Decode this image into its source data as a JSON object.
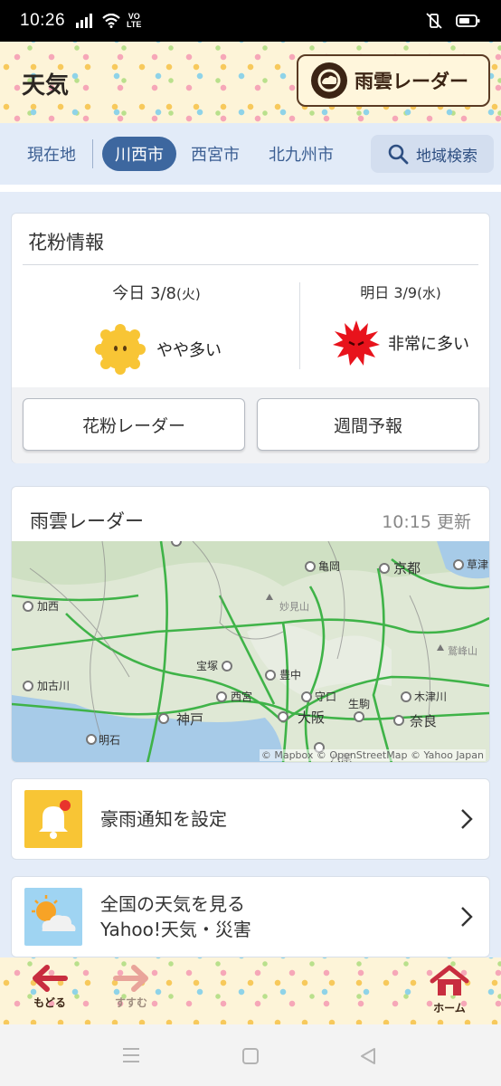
{
  "status_bar": {
    "time": "10:26",
    "volte": "VoLTE"
  },
  "header": {
    "title": "天気",
    "radar_button": "雨雲レーダー"
  },
  "location_tabs": {
    "items": [
      "現在地",
      "川西市",
      "西宮市",
      "北九州市"
    ],
    "active": "川西市",
    "search_label": "地域検索"
  },
  "pollen": {
    "title": "花粉情報",
    "today": {
      "label": "今日",
      "date": "3/8",
      "weekday": "(火)",
      "level": "やや多い"
    },
    "tomorrow": {
      "label": "明日",
      "date": "3/9",
      "weekday": "(水)",
      "level": "非常に多い"
    },
    "radar_button": "花粉レーダー",
    "weekly_button": "週間予報"
  },
  "rain_radar": {
    "title": "雨雲レーダー",
    "updated": "10:15 更新",
    "attribution": "© Mapbox © OpenStreetMap © Yahoo Japan",
    "places": [
      "亀岡",
      "京都",
      "草津",
      "加西",
      "妙見山",
      "鷲峰山",
      "宝塚",
      "豊中",
      "加古川",
      "西宮",
      "守口",
      "木津川",
      "生駒",
      "神戸",
      "大阪",
      "奈良",
      "明石",
      "八尾"
    ]
  },
  "rows": {
    "alert": "豪雨通知を設定",
    "national_line1": "全国の天気を見る",
    "national_line2": "Yahoo!天気・災害"
  },
  "bottom_nav": {
    "back": "もどる",
    "forward": "すすむ",
    "home": "ホーム"
  },
  "colors": {
    "accent_blue": "#3d679f",
    "pollen_medium": "#f8c535",
    "pollen_extreme": "#e8131c",
    "alert_yellow": "#f8c535"
  }
}
